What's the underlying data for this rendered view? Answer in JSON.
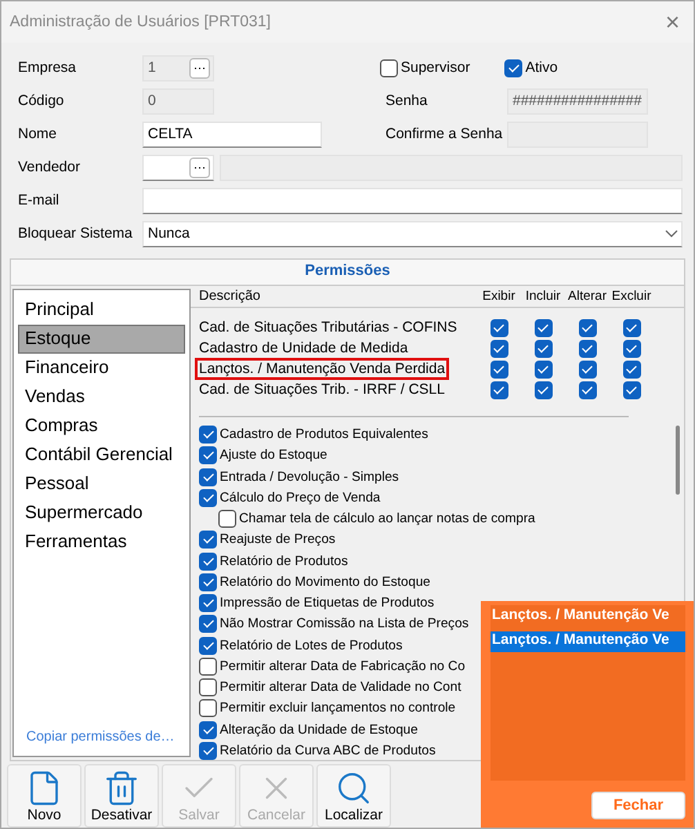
{
  "window": {
    "title": "Administração de Usuários [PRT031]",
    "close": "×"
  },
  "form": {
    "left": [
      {
        "kind": "lookup",
        "label": "Empresa",
        "value": "1",
        "button": "⋯",
        "disabled": true
      },
      {
        "kind": "text",
        "label": "Código",
        "value": "0",
        "disabled": true
      },
      {
        "kind": "text",
        "label": "Nome",
        "value": "CELTA",
        "disabled": false
      },
      {
        "kind": "lookup2",
        "label": "Vendedor",
        "button": "⋯",
        "disabled": false
      }
    ],
    "supervisor": {
      "label": "Supervisor",
      "checked": false
    },
    "ativo": {
      "label": "Ativo",
      "checked": true
    },
    "senha": {
      "label": "Senha",
      "value": "################"
    },
    "confirme": {
      "label": "Confirme a Senha"
    },
    "email": {
      "label": "E-mail"
    },
    "bloquear": {
      "label": "Bloquear Sistema",
      "value": "Nunca"
    }
  },
  "permissions": {
    "title": "Permissões",
    "categories": [
      {
        "label": "Principal",
        "selected": false
      },
      {
        "label": "Estoque",
        "selected": true
      },
      {
        "label": "Financeiro",
        "selected": false
      },
      {
        "label": "Vendas",
        "selected": false
      },
      {
        "label": "Compras",
        "selected": false
      },
      {
        "label": "Contábil Gerencial",
        "selected": false
      },
      {
        "label": "Pessoal",
        "selected": false
      },
      {
        "label": "Supermercado",
        "selected": false
      },
      {
        "label": "Ferramentas",
        "selected": false
      }
    ],
    "copy_link": "Copiar permissões de…",
    "columns": [
      "Descrição",
      "Exibir",
      "Incluir",
      "Alterar",
      "Excluir"
    ],
    "rows": [
      {
        "name": "Cad. de Situações Tributárias - COFINS",
        "marked": false,
        "checks": [
          true,
          true,
          true,
          true
        ]
      },
      {
        "name": "Cadastro de Unidade de Medida",
        "marked": false,
        "checks": [
          true,
          true,
          true,
          true
        ]
      },
      {
        "name": "Lançtos. / Manutenção Venda Perdida",
        "marked": true,
        "checks": [
          true,
          true,
          true,
          true
        ]
      },
      {
        "name": "Cad. de Situações Trib. - IRRF / CSLL",
        "marked": false,
        "checks": [
          true,
          true,
          true,
          true
        ]
      }
    ],
    "options": [
      {
        "label": "Cadastro de Produtos Equivalentes",
        "checked": true
      },
      {
        "label": "Ajuste do Estoque",
        "checked": true
      },
      {
        "label": "Entrada / Devolução - Simples",
        "checked": true
      },
      {
        "label": "Cálculo do Preço de Venda",
        "checked": true,
        "children": [
          {
            "label": "Chamar tela de cálculo ao lançar notas de compra",
            "checked": false
          }
        ]
      },
      {
        "label": "Reajuste de Preços",
        "checked": true
      },
      {
        "label": "Relatório de Produtos",
        "checked": true
      },
      {
        "label": "Relatório do Movimento do Estoque",
        "checked": true
      },
      {
        "label": "Impressão de Etiquetas de Produtos",
        "checked": true
      },
      {
        "label": "Não Mostrar Comissão na Lista de Preços",
        "checked": true
      },
      {
        "label": "Relatório de Lotes de Produtos",
        "checked": true
      },
      {
        "label": "Permitir alterar Data de Fabricação no Co",
        "checked": false
      },
      {
        "label": "Permitir alterar Data de Validade no Cont",
        "checked": false
      },
      {
        "label": "Permitir excluir lançamentos no controle",
        "checked": false
      },
      {
        "label": "Alteração da Unidade de Estoque",
        "checked": true
      },
      {
        "label": "Relatório da Curva  ABC de Produtos",
        "checked": true
      }
    ]
  },
  "toolbar": [
    {
      "kind": "new",
      "label": "Novo",
      "disabled": false
    },
    {
      "kind": "delete",
      "label": "Desativar",
      "disabled": false
    },
    {
      "kind": "save",
      "label": "Salvar",
      "disabled": true
    },
    {
      "kind": "cancel",
      "label": "Cancelar",
      "disabled": true
    },
    {
      "kind": "find",
      "label": "Localizar",
      "disabled": false
    }
  ],
  "search_popup": {
    "results": [
      {
        "label": "Lançtos. / Manutenção Ve",
        "selected": false
      },
      {
        "label": "Lançtos. / Manutenção Ve",
        "selected": true
      }
    ],
    "close": "Fechar"
  }
}
